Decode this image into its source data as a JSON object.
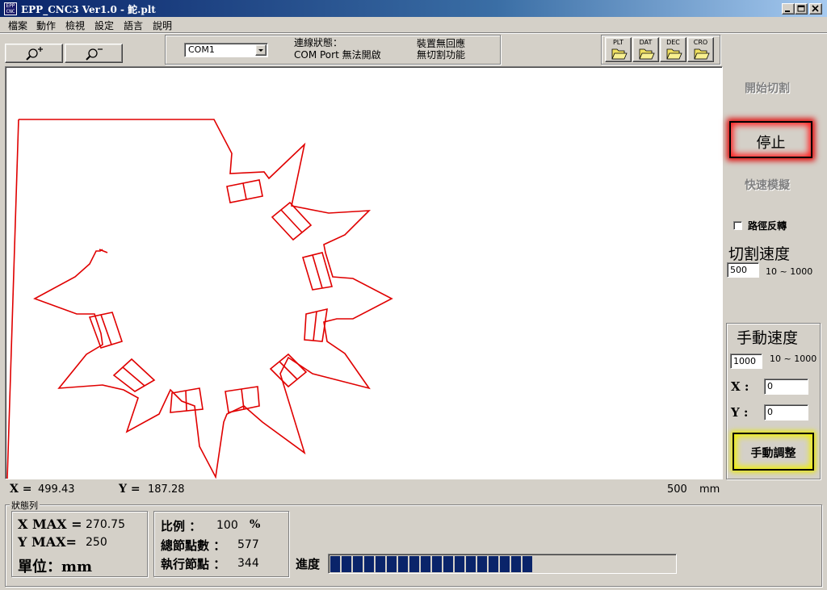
{
  "window": {
    "title": "EPP_CNC3 Ver1.0 - 鮀.plt",
    "app_icon_text": "EPP CNC"
  },
  "menu": [
    "檔案",
    "動作",
    "檢視",
    "設定",
    "語言",
    "說明"
  ],
  "toolbar": {
    "port_select": "COM1",
    "connection_label": "連線狀態：",
    "connection_status": "COM Port 無法開啟",
    "device_status_1": "裝置無回應",
    "device_status_2": "無切割功能",
    "file_buttons": [
      "PLT",
      "DAT",
      "DEC",
      "CRO"
    ]
  },
  "side": {
    "start_cut": "開始切割",
    "stop": "停止",
    "fast_sim": "快速模擬",
    "reverse_path": "路徑反轉",
    "reverse_checked": false,
    "cut_speed_title": "切割速度",
    "cut_speed_value": "500",
    "cut_speed_range": "10 ~ 1000",
    "manual_speed_title": "手動速度",
    "manual_speed_value": "1000",
    "manual_speed_range": "10 ~ 1000",
    "x_label": "X :",
    "x_value": "0",
    "y_label": "Y :",
    "y_value": "0",
    "manual_adjust": "手動調整"
  },
  "coords": {
    "x_label": "X =",
    "x_value": "499.43",
    "y_label": "Y =",
    "y_value": "187.28",
    "scale_value": "500",
    "scale_unit": "mm"
  },
  "status": {
    "title": "狀態列",
    "xmax_label": "X MAX =",
    "xmax_value": "270.75",
    "ymax_label": "Y MAX=",
    "ymax_value": "250",
    "unit_label": "單位：mm",
    "ratio_label": "比例 ：",
    "ratio_value": "100",
    "ratio_unit": "%",
    "total_nodes_label": "總節點數 ：",
    "total_nodes_value": "577",
    "exec_nodes_label": "執行節點 ：",
    "exec_nodes_value": "344",
    "progress_label": "進度",
    "progress": 0.59,
    "progress_color": "#0a246a"
  },
  "drawing_color": "#e00000"
}
